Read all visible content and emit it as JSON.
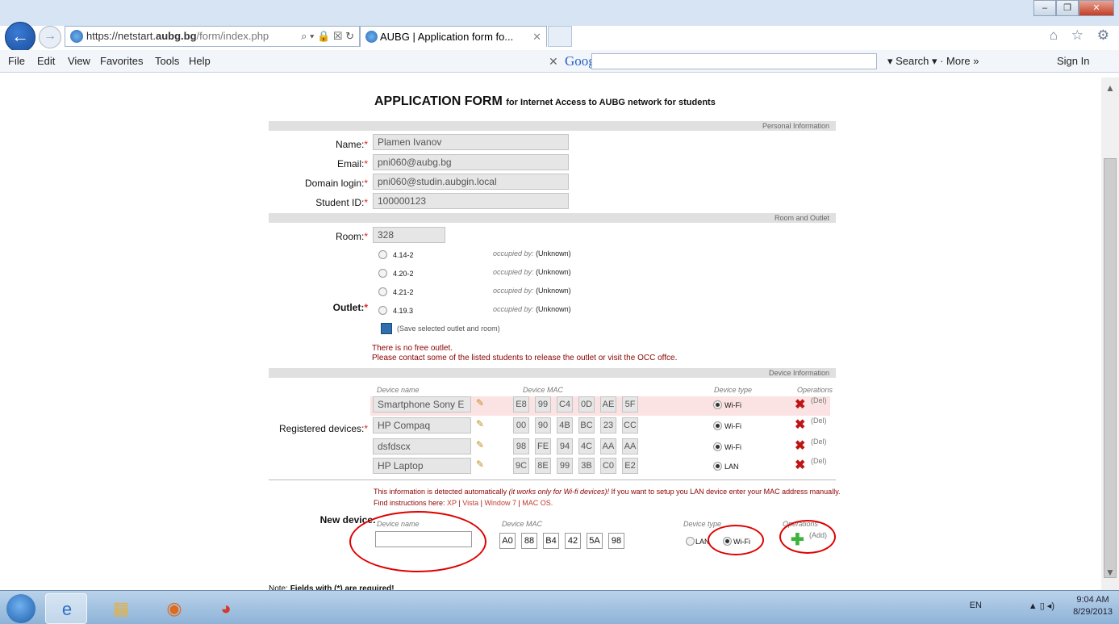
{
  "browser": {
    "url_prefix": "https://netstart.",
    "url_domain": "aubg.bg",
    "url_path": "/form/index.php",
    "addr_tools": "⌕ ▾ 🔒 ☒ ↻",
    "tab_title": "AUBG | Application form fo...",
    "tab_close": "✕",
    "menu": [
      "File",
      "Edit",
      "View",
      "Favorites",
      "Tools",
      "Help"
    ],
    "google_x": "✕",
    "google_logo": "Google",
    "google_tools": "▾ Search ▾ · More »",
    "sign_in": "Sign In",
    "chrome_icons": "⌂ ☆ ⚙",
    "win_min": "–",
    "win_max": "❐",
    "win_close": "✕"
  },
  "form": {
    "title": "APPLICATION FORM",
    "subtitle": "for Internet Access to AUBG network for students",
    "sections": {
      "personal": "Personal Information",
      "room": "Room and Outlet",
      "device": "Device Information"
    },
    "labels": {
      "name": "Name:",
      "email": "Email:",
      "domain_login": "Domain login:",
      "student_id": "Student ID:",
      "room": "Room:",
      "outlet": "Outlet:",
      "registered_devices": "Registered devices:",
      "new_device": "New device:",
      "required_mark": "*"
    },
    "values": {
      "name": "Plamen Ivanov",
      "email": "pni060@aubg.bg",
      "domain_login": "pni060@studin.aubgin.local",
      "student_id": "100000123",
      "room": "328"
    },
    "outlets": [
      {
        "label": "4.14-2",
        "occupied_label": "occupied by:",
        "occupied_by": "(Unknown)"
      },
      {
        "label": "4.20-2",
        "occupied_label": "occupied by:",
        "occupied_by": "(Unknown)"
      },
      {
        "label": "4.21-2",
        "occupied_label": "occupied by:",
        "occupied_by": "(Unknown)"
      },
      {
        "label": "4.19.3",
        "occupied_label": "occupied by:",
        "occupied_by": "(Unknown)"
      }
    ],
    "save_outlet": "(Save selected outlet and room)",
    "no_outlet_msg": "There is no free outlet.",
    "contact_msg": "Please contact some of the listed students to release the outlet or visit the OCC offce.",
    "columns": {
      "device_name": "Device name",
      "device_mac": "Device MAC",
      "device_type": "Device type",
      "operations": "Operations"
    },
    "devices": [
      {
        "name": "Smartphone Sony E",
        "mac": [
          "E8",
          "99",
          "C4",
          "0D",
          "AE",
          "5F"
        ],
        "type": "Wi-Fi",
        "del": "(Del)"
      },
      {
        "name": "HP Compaq",
        "mac": [
          "00",
          "90",
          "4B",
          "BC",
          "23",
          "CC"
        ],
        "type": "Wi-Fi",
        "del": "(Del)"
      },
      {
        "name": "dsfdscx",
        "mac": [
          "98",
          "FE",
          "94",
          "4C",
          "AA",
          "AA"
        ],
        "type": "Wi-Fi",
        "del": "(Del)"
      },
      {
        "name": "HP Laptop",
        "mac": [
          "9C",
          "8E",
          "99",
          "3B",
          "C0",
          "E2"
        ],
        "type": "LAN",
        "del": "(Del)"
      }
    ],
    "info_1": "This information is detected automatically",
    "info_italic": "(it works only for Wi-fi devices)!",
    "info_2": " If you want to setup you LAN device enter your MAC address manually. Find instructions here: ",
    "links": [
      "XP",
      "Vista",
      "Window 7",
      "MAC OS."
    ],
    "link_sep": " | ",
    "new_device": {
      "name_value": "",
      "mac": [
        "A0",
        "88",
        "B4",
        "42",
        "5A",
        "98"
      ],
      "type_lan": "LAN",
      "type_wifi": "Wi-Fi",
      "add": "(Add)"
    },
    "note_prefix": "Note: ",
    "note_text": "Fields with (*) are required!"
  },
  "taskbar": {
    "lang": "EN",
    "tray_icons": "▲ ▯ ◂)",
    "time": "9:04 AM",
    "date": "8/29/2013"
  },
  "colors": {
    "annotation": "#e00000",
    "error_text": "#8b0000",
    "delete_icon": "#c01414",
    "add_icon": "#3cb43c"
  }
}
